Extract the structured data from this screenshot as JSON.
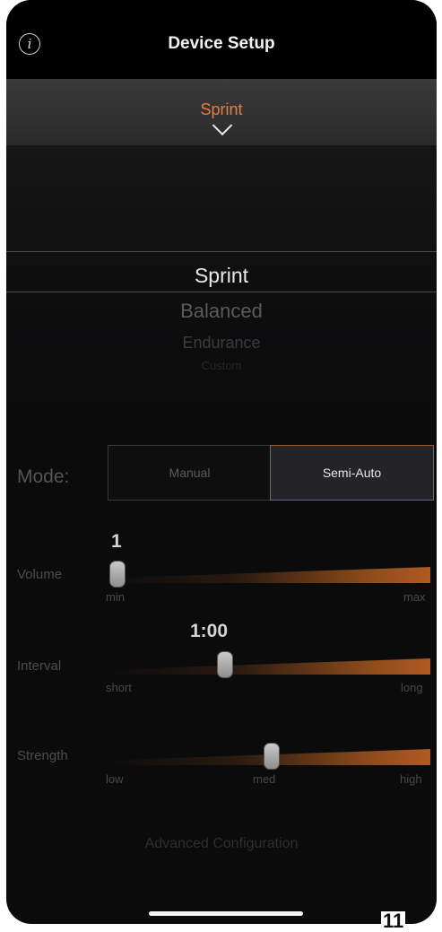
{
  "header": {
    "title": "Device Setup",
    "info_icon": "info-circle-icon"
  },
  "selector": {
    "value": "Sprint",
    "icon": "chevron-down-icon"
  },
  "picker": {
    "options": [
      "Sprint",
      "Balanced",
      "Endurance",
      "Custom"
    ],
    "selected": "Sprint"
  },
  "mode": {
    "label": "Mode:",
    "options": [
      "Manual",
      "Semi-Auto"
    ],
    "selected": "Semi-Auto"
  },
  "sliders": {
    "volume": {
      "label": "Volume",
      "value": "1",
      "min_label": "min",
      "max_label": "max",
      "level": 0.0
    },
    "interval": {
      "label": "Interval",
      "value": "1:00",
      "min_label": "short",
      "max_label": "long",
      "level": 0.35
    },
    "strength": {
      "label": "Strength",
      "low_label": "low",
      "mid_label": "med",
      "high_label": "high",
      "level": 0.5
    }
  },
  "advanced": {
    "label": "Advanced Configuration"
  },
  "page_number": "11",
  "colors": {
    "accent": "#ee7a33",
    "background": "#0b0b0c"
  }
}
